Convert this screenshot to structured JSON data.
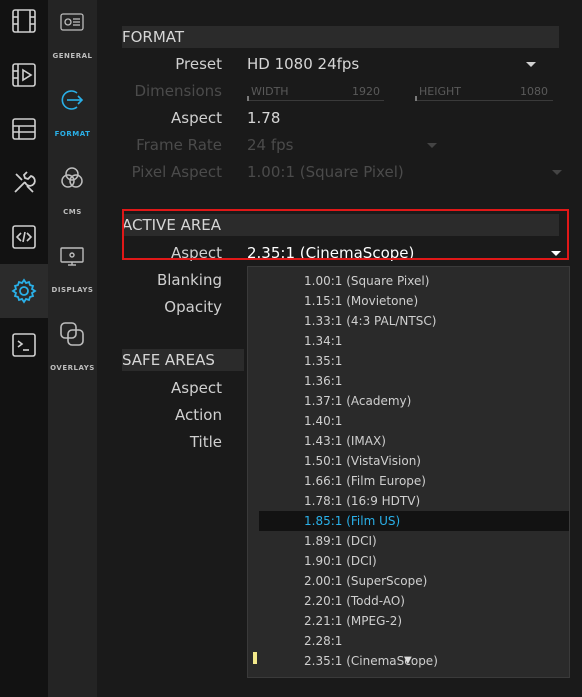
{
  "sidebar_icons": [
    {
      "name": "film-strip-icon"
    },
    {
      "name": "film-play-icon"
    },
    {
      "name": "table-icon"
    },
    {
      "name": "tools-icon"
    },
    {
      "name": "code-icon"
    },
    {
      "name": "settings-gear-icon"
    },
    {
      "name": "terminal-icon"
    }
  ],
  "sections_nav": [
    {
      "label": "GENERAL",
      "icon": "general-panel-icon"
    },
    {
      "label": "FORMAT",
      "icon": "format-arrow-icon"
    },
    {
      "label": "CMS",
      "icon": "cms-circles-icon"
    },
    {
      "label": "DISPLAYS",
      "icon": "displays-monitor-icon"
    },
    {
      "label": "OVERLAYS",
      "icon": "overlays-squares-icon"
    }
  ],
  "format": {
    "header": "FORMAT",
    "preset_label": "Preset",
    "preset_value": "HD 1080 24fps",
    "dimensions_label": "Dimensions",
    "width_label": "WIDTH",
    "width_value": "1920",
    "height_label": "HEIGHT",
    "height_value": "1080",
    "aspect_label": "Aspect",
    "aspect_value": "1.78",
    "frame_rate_label": "Frame Rate",
    "frame_rate_value": "24 fps",
    "pixel_aspect_label": "Pixel Aspect",
    "pixel_aspect_value": "1.00:1 (Square Pixel)"
  },
  "active_area": {
    "header": "ACTIVE AREA",
    "aspect_label": "Aspect",
    "aspect_value": "2.35:1 (CinemaScope)",
    "blanking_label": "Blanking",
    "opacity_label": "Opacity"
  },
  "safe_areas": {
    "header": "SAFE AREAS",
    "aspect_label": "Aspect",
    "action_label": "Action",
    "title_label": "Title"
  },
  "aspect_options": [
    "1.00:1 (Square Pixel)",
    "1.15:1 (Movietone)",
    "1.33:1 (4:3 PAL/NTSC)",
    "1.34:1",
    "1.35:1",
    "1.36:1",
    "1.37:1 (Academy)",
    "1.40:1",
    "1.43:1 (IMAX)",
    "1.50:1 (VistaVision)",
    "1.66:1 (Film Europe)",
    "1.78:1 (16:9 HDTV)",
    "1.85:1 (Film US)",
    "1.89:1 (DCI)",
    "1.90:1 (DCI)",
    "2.00:1 (SuperScope)",
    "2.20:1 (Todd-AO)",
    "2.21:1 (MPEG-2)",
    "2.28:1",
    "2.35:1 (CinemaScope)"
  ],
  "highlighted_option_index": 12,
  "colors": {
    "accent": "#2ab0e8",
    "highlight_box": "#e01818"
  }
}
